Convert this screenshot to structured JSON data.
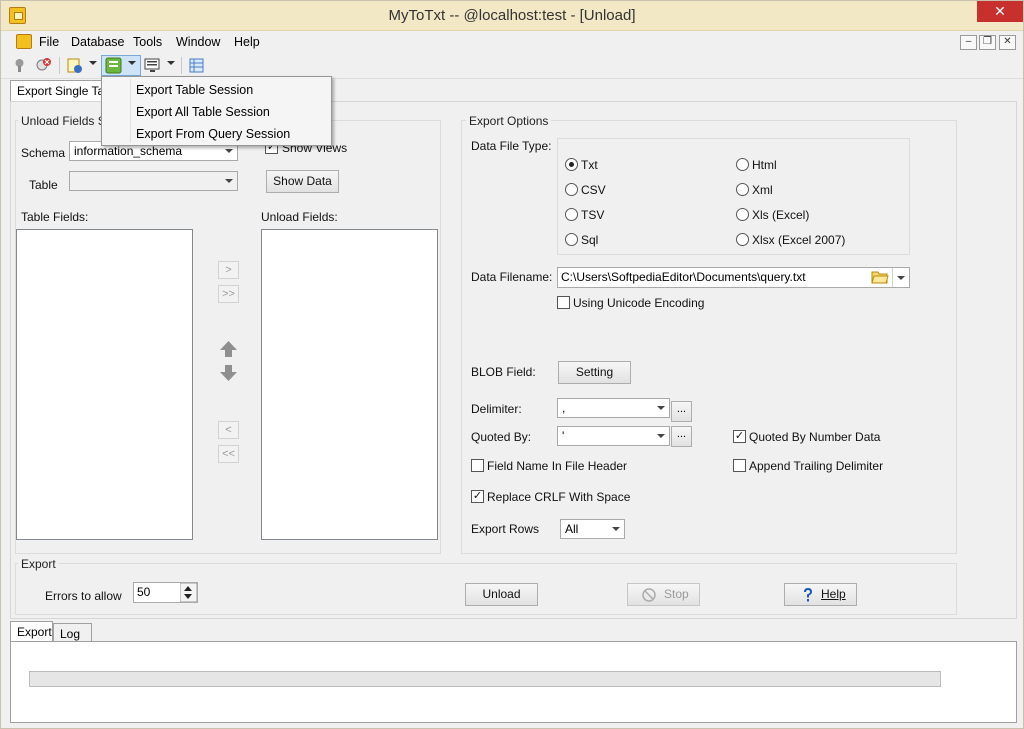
{
  "window": {
    "title": "MyToTxt -- @localhost:test - [Unload]",
    "close": "✕"
  },
  "menu": {
    "items": [
      "File",
      "Database",
      "Tools",
      "Window",
      "Help"
    ]
  },
  "mdi": {
    "minimize": "–",
    "restore": "❐",
    "close": "✕"
  },
  "dropdown": {
    "items": [
      "Export Table Session",
      "Export All Table Session",
      "Export From Query Session"
    ]
  },
  "tabs_top": {
    "active": "Export Single Table"
  },
  "unload_fields": {
    "group_label": "Unload Fields Se",
    "schema_label": "Schema",
    "schema_value": "information_schema",
    "show_views": "Show Views",
    "table_label": "Table",
    "table_value": "",
    "show_data": "Show Data",
    "table_fields_label": "Table Fields:",
    "unload_fields_label": "Unload Fields:",
    "btn_add": ">",
    "btn_add_all": ">>",
    "btn_remove": "<",
    "btn_remove_all": "<<"
  },
  "export_options": {
    "group_label": "Export Options",
    "data_file_type_label": "Data File Type:",
    "types_left": [
      "Txt",
      "CSV",
      "TSV",
      "Sql"
    ],
    "types_right": [
      "Html",
      "Xml",
      "Xls (Excel)",
      "Xlsx (Excel 2007)"
    ],
    "selected_type": "Txt",
    "data_filename_label": "Data Filename:",
    "data_filename_value": "C:\\Users\\SoftpediaEditor\\Documents\\query.txt",
    "unicode_label": "Using Unicode Encoding",
    "blob_label": "BLOB Field:",
    "setting": "Setting",
    "delimiter_label": "Delimiter:",
    "delimiter_value": ",",
    "quoted_by_label": "Quoted By:",
    "quoted_by_value": "'",
    "ellipsis": "...",
    "quoted_by_number": "Quoted By Number Data",
    "field_name_header": "Field Name In File Header",
    "append_trailing": "Append Trailing Delimiter",
    "replace_crlf": "Replace CRLF With Space",
    "export_rows_label": "Export Rows",
    "export_rows_value": "All",
    "check_mark": "✓"
  },
  "export": {
    "group_label": "Export",
    "errors_label": "Errors to allow",
    "errors_value": "50",
    "unload": "Unload",
    "stop": "Stop",
    "help": "Help"
  },
  "bottom_tabs": {
    "export": "Export",
    "log": "Log"
  },
  "progress": {
    "value": 0
  }
}
